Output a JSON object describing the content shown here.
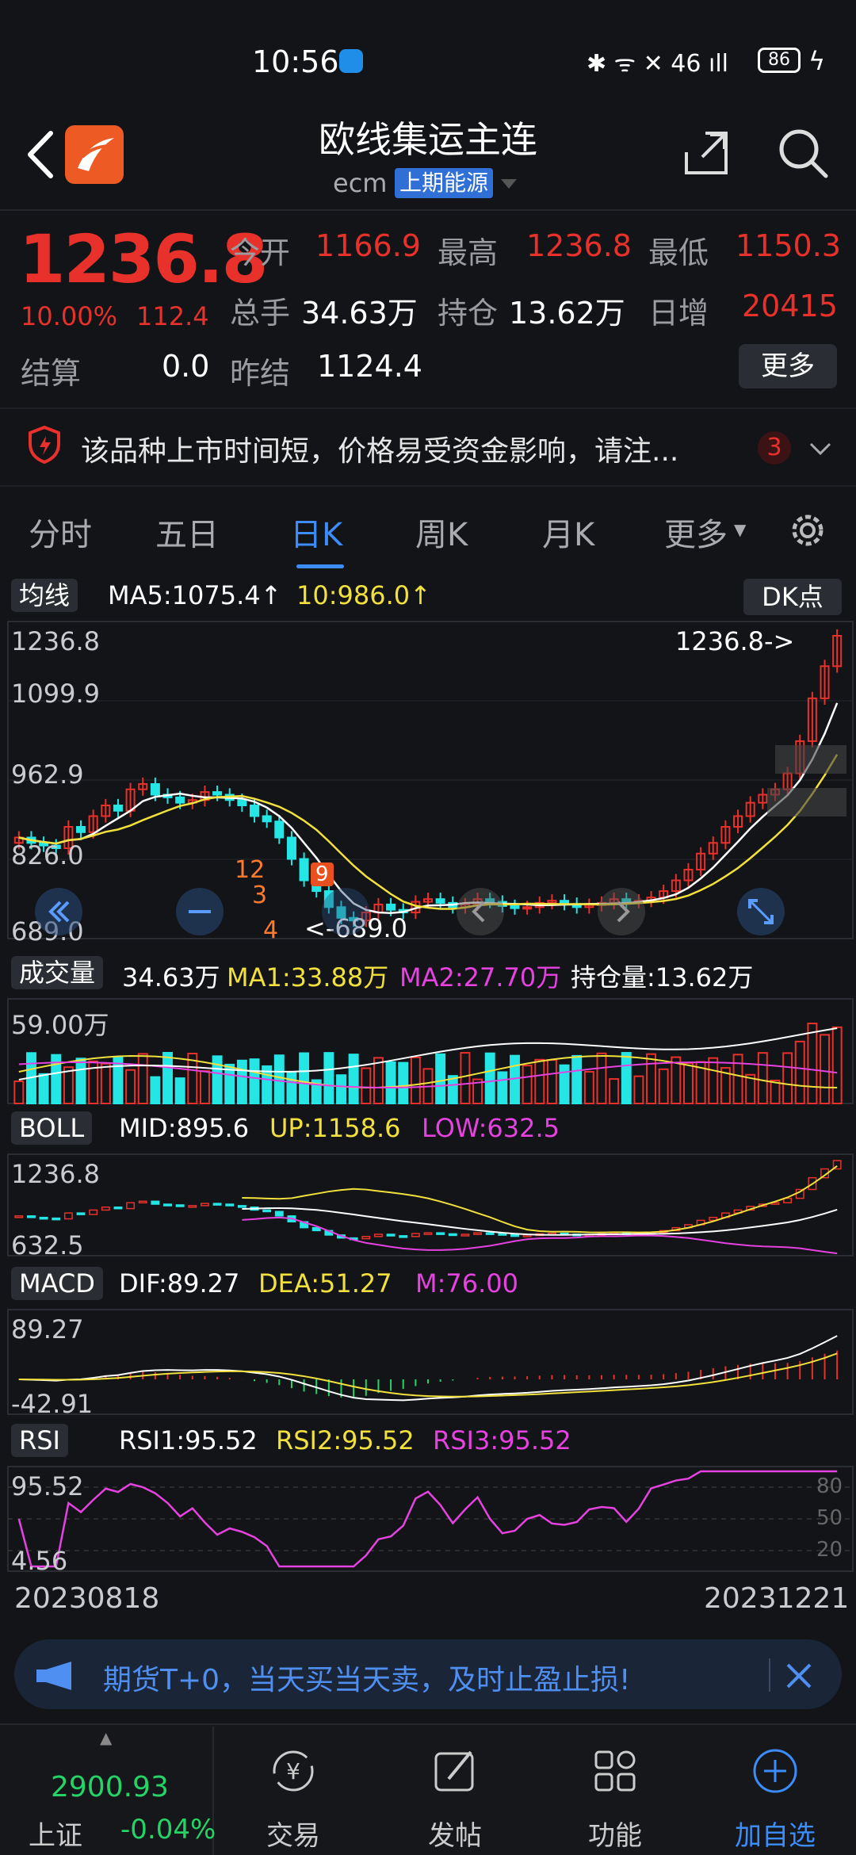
{
  "status_bar": {
    "time": "10:56",
    "icons": "✱ ᯤ ✕ 46 ıll",
    "battery": "86"
  },
  "header": {
    "title": "欧线集运主连",
    "code": "ecm",
    "exchange": "上期能源"
  },
  "quote": {
    "last_price": "1236.8",
    "change_pct": "10.00%",
    "change_val": "112.4",
    "fields": [
      {
        "label": "今开",
        "value": "1166.9"
      },
      {
        "label": "最高",
        "value": "1236.8"
      },
      {
        "label": "最低",
        "value": "1150.3"
      },
      {
        "label": "总手",
        "value": "34.63万"
      },
      {
        "label": "持仓",
        "value": "13.62万"
      },
      {
        "label": "日增",
        "value": "20415"
      }
    ],
    "settle_label": "结算",
    "settle_value": "0.0",
    "prev_settle_label": "昨结",
    "prev_settle_value": "1124.4",
    "more_label": "更多"
  },
  "notice": {
    "text": "该品种上市时间短，价格易受资金影响，请注...",
    "count": "3"
  },
  "tabs": [
    {
      "label": "分时"
    },
    {
      "label": "五日"
    },
    {
      "label": "日K"
    },
    {
      "label": "周K"
    },
    {
      "label": "月K"
    },
    {
      "label": "更多"
    }
  ],
  "chart": {
    "ma_button": "均线",
    "ma5": "MA5:1075.4↑",
    "ma10": "10:986.0↑",
    "dk_button": "DK点",
    "y_labels": [
      "1236.8",
      "1099.9",
      "962.9",
      "826.0",
      "689.0"
    ],
    "high_marker": "1236.8->",
    "low_marker": "<-689.0",
    "seq_marks": [
      "12",
      "3",
      "4",
      "9"
    ],
    "vol_button": "成交量",
    "vol_value": "34.63万",
    "vol_ma1": "MA1:33.88万",
    "vol_ma2": "MA2:27.70万",
    "open_interest": "持仓量:13.62万",
    "vol_axis": "59.00万",
    "boll_button": "BOLL",
    "boll_mid": "MID:895.6",
    "boll_up": "UP:1158.6",
    "boll_low": "LOW:632.5",
    "boll_axis_top": "1236.8",
    "boll_axis_bottom": "632.5",
    "macd_button": "MACD",
    "macd_dif": "DIF:89.27",
    "macd_dea": "DEA:51.27",
    "macd_m": "M:76.00",
    "macd_axis_top": "89.27",
    "macd_axis_bottom": "-42.91",
    "rsi_button": "RSI",
    "rsi1": "RSI1:95.52",
    "rsi2": "RSI2:95.52",
    "rsi3": "RSI3:95.52",
    "rsi_axis_top": "95.52",
    "rsi_axis_bottom": "4.56",
    "rsi_levels": [
      "80",
      "50",
      "20"
    ],
    "date_start": "20230818",
    "date_end": "20231221"
  },
  "chart_data": {
    "type": "candlestick",
    "x_range": [
      "20230818",
      "20231221"
    ],
    "price_axis": [
      689.0,
      1236.8
    ],
    "close_series": [
      860,
      850,
      845,
      840,
      880,
      870,
      900,
      920,
      910,
      950,
      960,
      940,
      935,
      925,
      930,
      945,
      940,
      930,
      920,
      900,
      890,
      860,
      820,
      780,
      760,
      730,
      710,
      705,
      720,
      735,
      725,
      720,
      740,
      745,
      738,
      730,
      735,
      745,
      740,
      732,
      728,
      730,
      738,
      742,
      736,
      730,
      734,
      738,
      745,
      740,
      742,
      748,
      760,
      780,
      800,
      830,
      850,
      880,
      900,
      925,
      940,
      950,
      980,
      1040,
      1120,
      1180,
      1236.8
    ],
    "last_price": 1236.8,
    "low_marked": 689.0,
    "colors": {
      "up": "#e8312a",
      "down": "#25e5e5",
      "ma5": "#ffffff",
      "ma10": "#f2e03c",
      "ma2": "#e542e0"
    }
  },
  "promo": {
    "text": "期货T+0，当天买当天卖，及时止盈止损!"
  },
  "bottom_nav": {
    "index_value": "2900.93",
    "index_name": "上证",
    "index_change": "-0.04%",
    "items": [
      {
        "label": "交易"
      },
      {
        "label": "发帖"
      },
      {
        "label": "功能"
      },
      {
        "label": "加自选"
      }
    ]
  }
}
